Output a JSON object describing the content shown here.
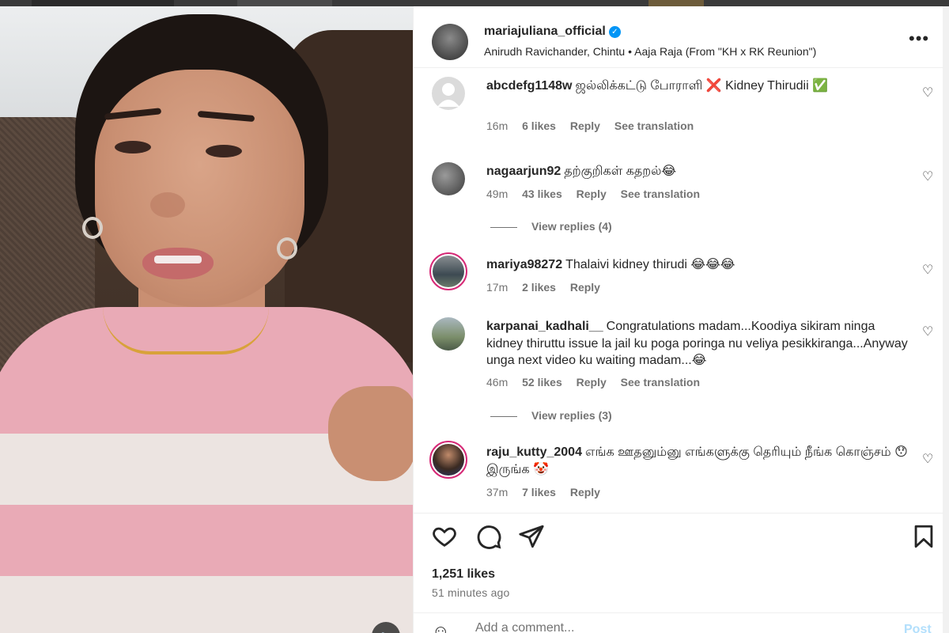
{
  "colors": {
    "accent": "#0095f6",
    "text": "#262626",
    "muted": "#737373"
  },
  "post": {
    "username": "mariajuliana_official",
    "verified_icon": "verified-badge-icon",
    "audio": "Anirudh Ravichander, Chintu • Aaja Raja (From \"KH x RK Reunion\")",
    "more_icon": "more-options-icon"
  },
  "comments": [
    {
      "user": "abcdefg1148w",
      "text": "ஜல்லிக்கட்டு போராளி ❌ Kidney Thirudii ✅",
      "time": "16m",
      "likes": "6 likes",
      "reply": "Reply",
      "translate": "See translation"
    },
    {
      "user": "nagaarjun92",
      "text": "தற்குறிகள் கதறல்😂",
      "time": "49m",
      "likes": "43 likes",
      "reply": "Reply",
      "translate": "See translation",
      "view_replies": "View replies (4)"
    },
    {
      "user": "mariya98272",
      "text": "Thalaivi kidney thirudi 😂😂😂",
      "time": "17m",
      "likes": "2 likes",
      "reply": "Reply"
    },
    {
      "user": "karpanai_kadhali__",
      "text": "Congratulations madam...Koodiya sikiram ninga kidney thiruttu issue la jail ku poga poringa nu veliya pesikkiranga...Anyway unga next video ku waiting madam...😂",
      "time": "46m",
      "likes": "52 likes",
      "reply": "Reply",
      "translate": "See translation",
      "view_replies": "View replies (3)"
    },
    {
      "user": "raju_kutty_2004",
      "text": "எங்க ஊதனும்னு எங்களுக்கு தெரியும் நீங்க கொஞ்சம் 😯 இருங்க 🤡",
      "time": "37m",
      "likes": "7 likes",
      "reply": "Reply"
    }
  ],
  "actions": {
    "like_icon": "heart-icon",
    "comment_icon": "comment-icon",
    "share_icon": "share-icon",
    "save_icon": "bookmark-icon",
    "likes": "1,251 likes",
    "time": "51 minutes ago"
  },
  "composer": {
    "emoji_icon": "emoji-icon",
    "placeholder": "Add a comment...",
    "post_label": "Post"
  },
  "video": {
    "mute_icon": "speaker-icon"
  }
}
